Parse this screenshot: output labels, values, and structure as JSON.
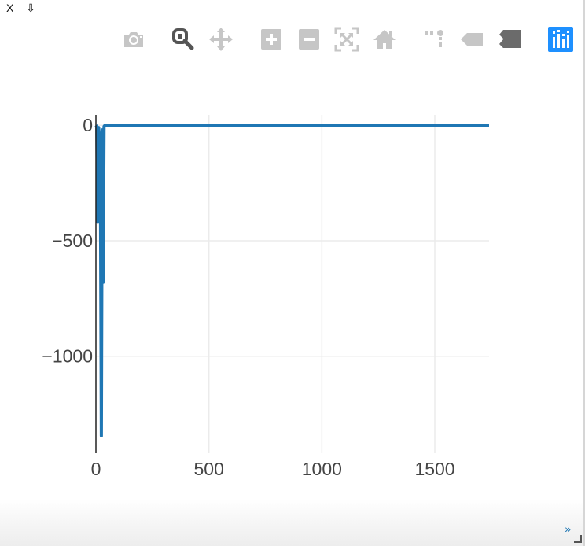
{
  "controls": {
    "close_label": "X",
    "download_label": "⇩"
  },
  "modebar": {
    "buttons": [
      {
        "name": "camera-icon",
        "title": "Download plot as png"
      },
      {
        "name": "zoom-icon",
        "title": "Zoom"
      },
      {
        "name": "pan-icon",
        "title": "Pan"
      },
      {
        "name": "zoom-in-icon",
        "title": "Zoom in"
      },
      {
        "name": "zoom-out-icon",
        "title": "Zoom out"
      },
      {
        "name": "autoscale-icon",
        "title": "Autoscale"
      },
      {
        "name": "home-icon",
        "title": "Reset axes"
      },
      {
        "name": "spike-lines-icon",
        "title": "Toggle Spike Lines"
      },
      {
        "name": "hover-closest-icon",
        "title": "Show closest data on hover"
      },
      {
        "name": "hover-compare-icon",
        "title": "Compare data on hover"
      },
      {
        "name": "plotly-logo-icon",
        "title": "Produced with Plotly"
      }
    ],
    "active": "zoom-icon",
    "colors": {
      "inactive": "#c6c6c6",
      "active": "#555555",
      "compare": "#6b6b6b",
      "brand": "#1e90ff"
    }
  },
  "chart_data": {
    "type": "line",
    "title": "",
    "xlabel": "",
    "ylabel": "",
    "xlim": [
      0,
      1740
    ],
    "ylim": [
      -1420,
      45
    ],
    "xticks": [
      0,
      500,
      1000,
      1500
    ],
    "xtick_labels": [
      "0",
      "500",
      "1000",
      "1500"
    ],
    "yticks": [
      0,
      -500,
      -1000
    ],
    "ytick_labels": [
      "0",
      "−500",
      "−1000"
    ],
    "grid": true,
    "legend": "none",
    "series": [
      {
        "color": "#1f77b4",
        "x": [
          0,
          4,
          8,
          12,
          16,
          20,
          24,
          28,
          32,
          36,
          40,
          60,
          100,
          200,
          400,
          600,
          800,
          1000,
          1200,
          1400,
          1600,
          1740
        ],
        "y": [
          0,
          -5,
          -420,
          -10,
          -50,
          -250,
          -1345,
          -20,
          -680,
          -5,
          0,
          0,
          0,
          0,
          0,
          0,
          0,
          0,
          0,
          0,
          0,
          0
        ]
      }
    ]
  }
}
